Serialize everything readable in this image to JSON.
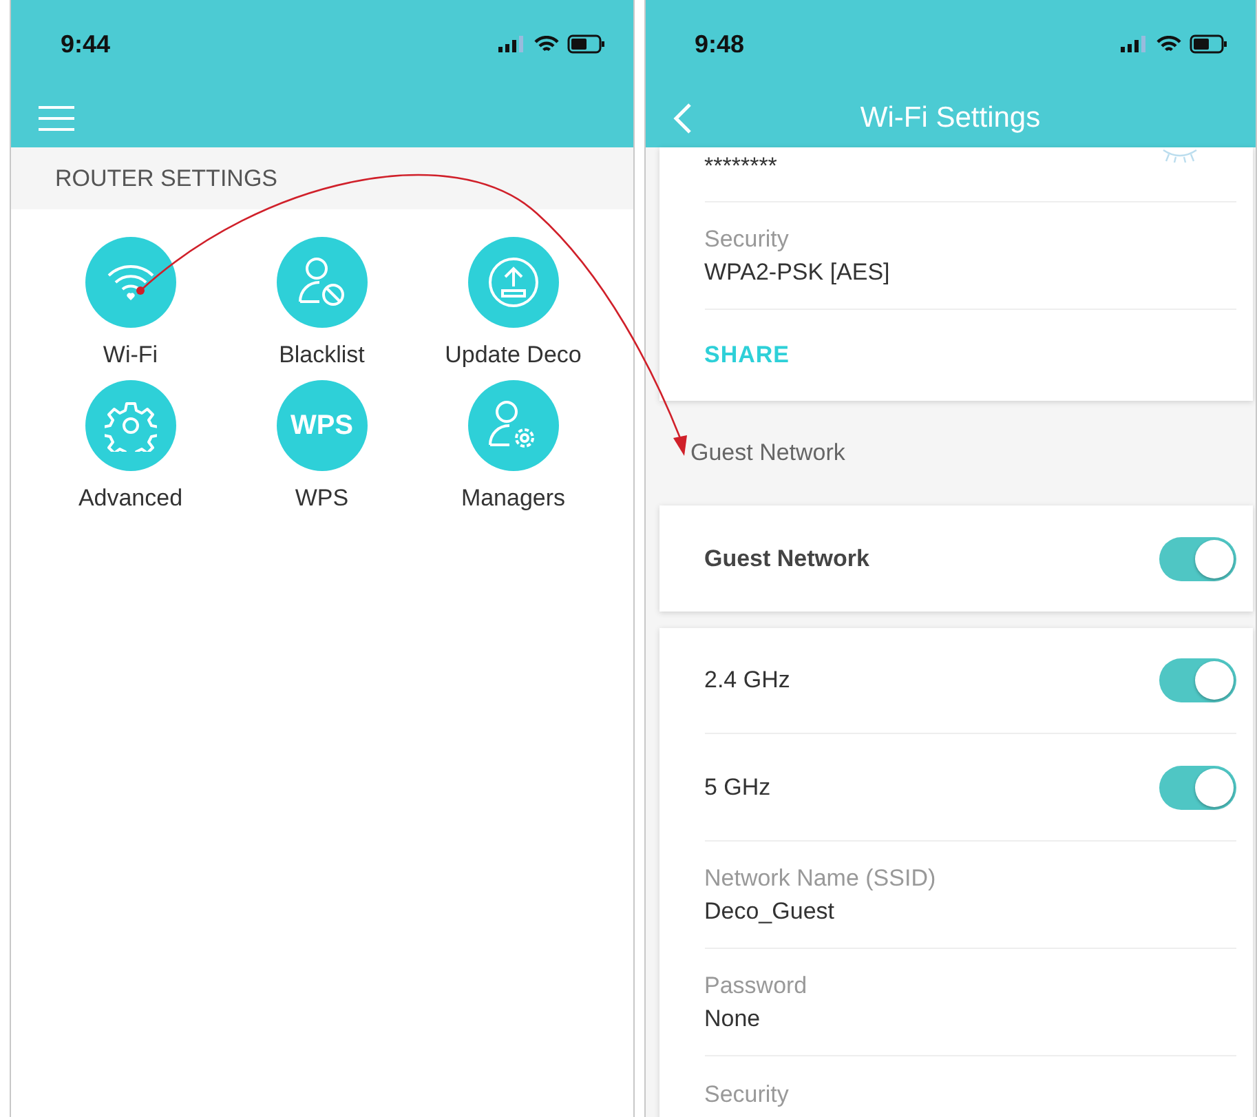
{
  "left_screen": {
    "status_bar": {
      "time": "9:44"
    },
    "section_title": "ROUTER SETTINGS",
    "tiles": [
      {
        "label": "Wi-Fi",
        "kind": "wifi"
      },
      {
        "label": "Blacklist",
        "kind": "blocked-user"
      },
      {
        "label": "Update Deco",
        "kind": "upload"
      },
      {
        "label": "Advanced",
        "kind": "gear"
      },
      {
        "label": "WPS",
        "kind": "text",
        "icon_text": "WPS"
      },
      {
        "label": "Managers",
        "kind": "user-gear"
      }
    ]
  },
  "right_screen": {
    "status_bar": {
      "time": "9:48"
    },
    "title": "Wi-Fi Settings",
    "password_mask": "********",
    "fields": [
      {
        "label": "Security",
        "value": "WPA2-PSK [AES]"
      }
    ],
    "share": "SHARE",
    "section_title": "Guest Network",
    "guest_toggle": {
      "label": "Guest Network",
      "on": true
    },
    "bands": [
      {
        "label": "2.4 GHz",
        "on": true
      },
      {
        "label": "5 GHz",
        "on": true
      }
    ],
    "guest_fields": [
      {
        "label": "Network Name (SSID)",
        "value": "Deco_Guest"
      },
      {
        "label": "Password",
        "value": "None"
      }
    ],
    "trailing_label": "Security"
  }
}
